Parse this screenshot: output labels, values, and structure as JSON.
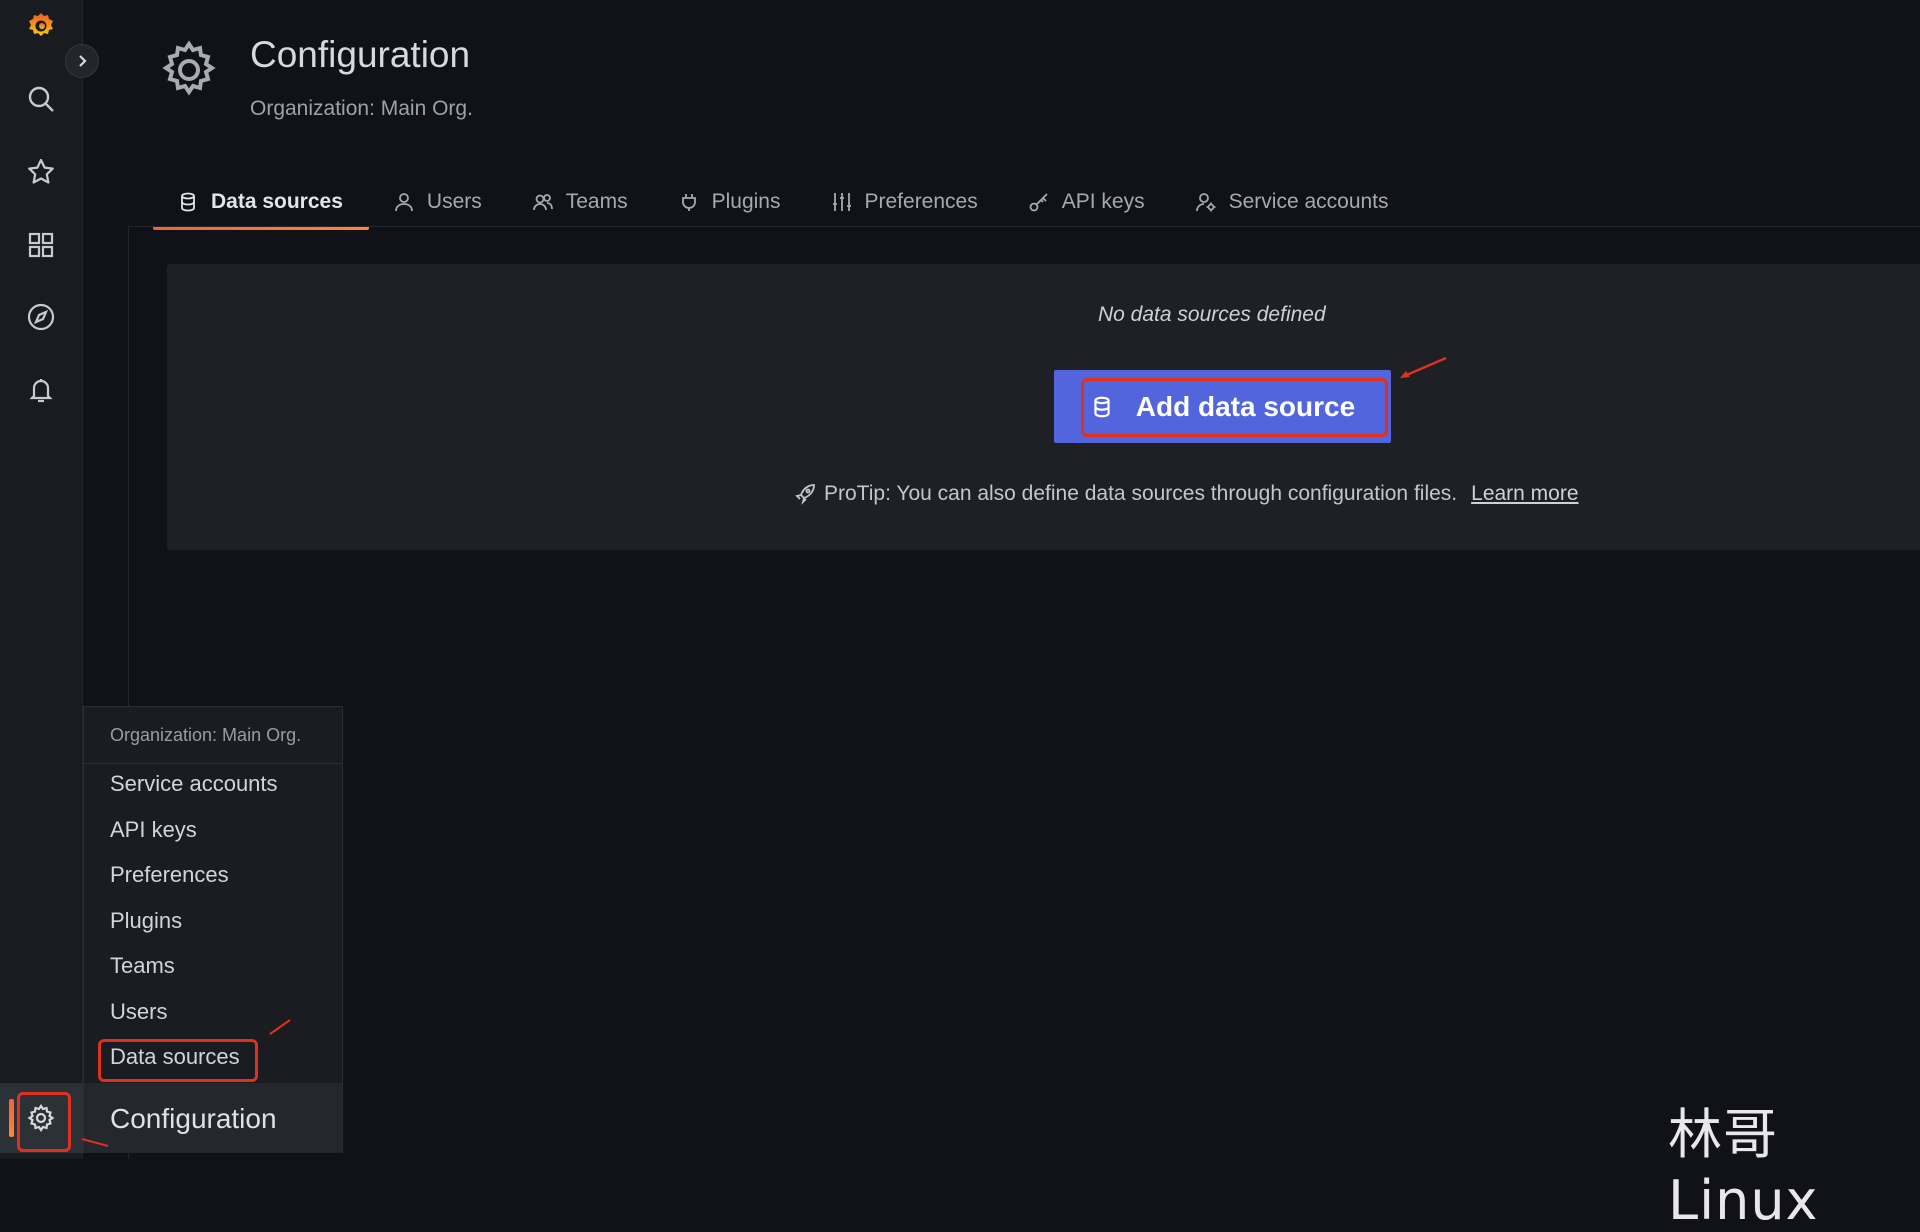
{
  "header": {
    "title": "Configuration",
    "subtitle": "Organization: Main Org."
  },
  "tabs": [
    {
      "label": "Data sources",
      "icon": "database-icon",
      "active": true
    },
    {
      "label": "Users",
      "icon": "user-icon",
      "active": false
    },
    {
      "label": "Teams",
      "icon": "users-icon",
      "active": false
    },
    {
      "label": "Plugins",
      "icon": "plug-icon",
      "active": false
    },
    {
      "label": "Preferences",
      "icon": "sliders-icon",
      "active": false
    },
    {
      "label": "API keys",
      "icon": "key-icon",
      "active": false
    },
    {
      "label": "Service accounts",
      "icon": "user-gear-icon",
      "active": false
    }
  ],
  "empty_state": {
    "message": "No data sources defined",
    "button_label": "Add data source",
    "protip": "ProTip: You can also define data sources through configuration files.",
    "learn_more": "Learn more"
  },
  "nav": {
    "items": [
      "grafana-logo",
      "search-icon",
      "star-icon",
      "dashboards-icon",
      "explore-icon",
      "alerting-bell-icon",
      "configuration-gear-icon"
    ]
  },
  "flyout": {
    "org": "Organization: Main Org.",
    "items": [
      "Service accounts",
      "API keys",
      "Preferences",
      "Plugins",
      "Teams",
      "Users",
      "Data sources"
    ],
    "footer": "Configuration"
  },
  "watermark": "林哥Linux",
  "colors": {
    "accent_orange": "#f55f3e",
    "primary_button": "#5265dd",
    "annotation_red": "#e0301e",
    "background": "#111217"
  }
}
